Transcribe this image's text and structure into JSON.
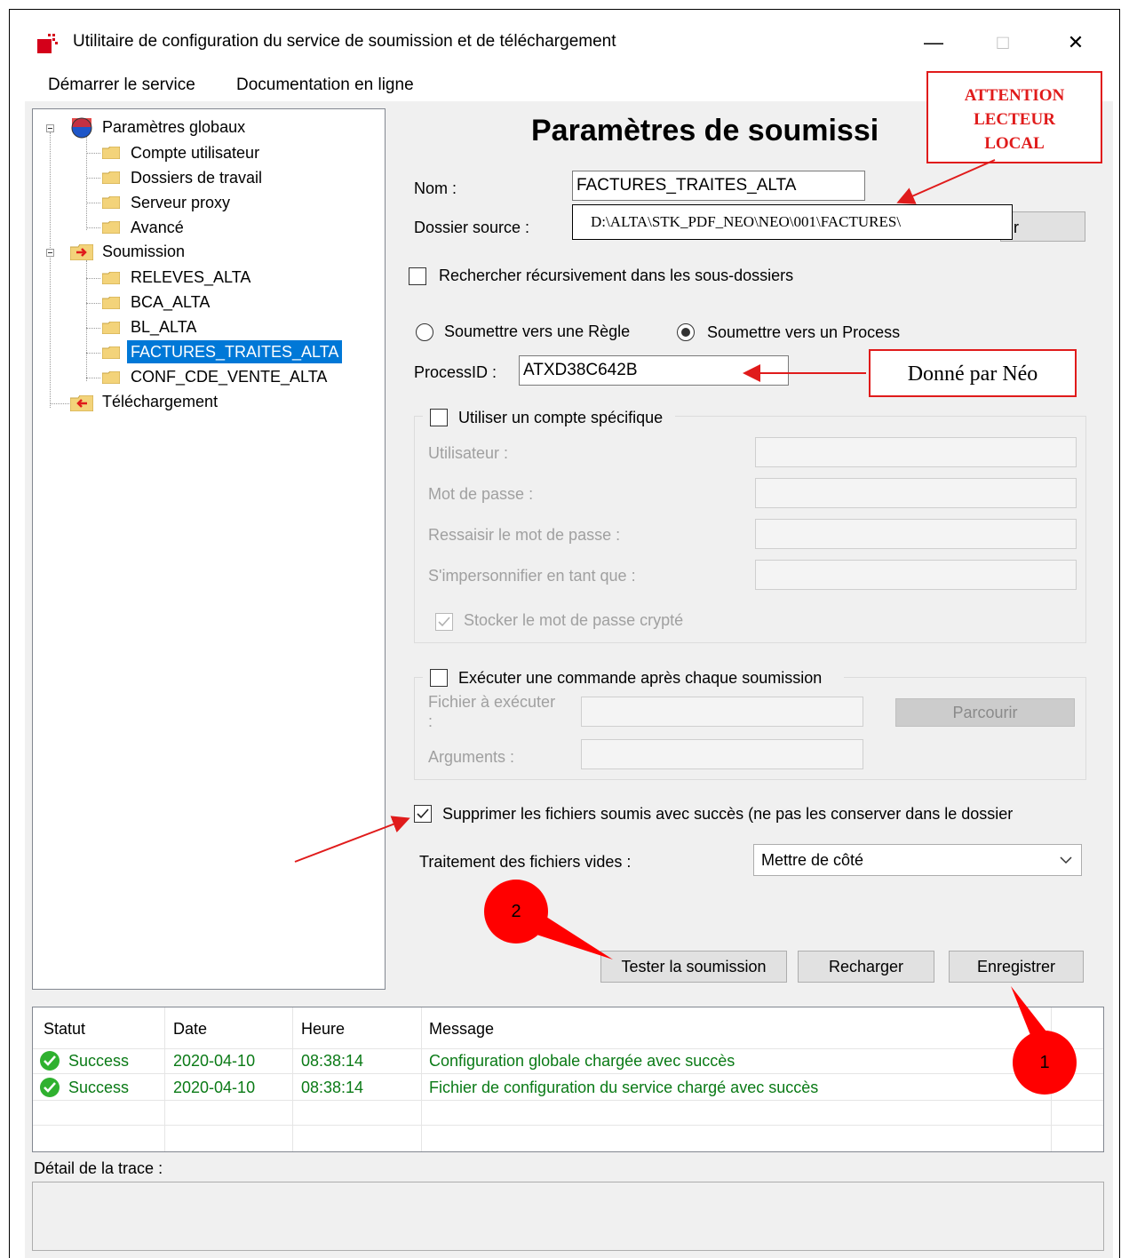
{
  "window": {
    "title": "Utilitaire de configuration du service de soumission et de téléchargement",
    "minimize": "—",
    "maximize": "□",
    "close": "✕"
  },
  "menu": [
    "Démarrer le service",
    "Documentation en ligne"
  ],
  "tree": {
    "global": "Paramètres globaux",
    "global_items": [
      "Compte utilisateur",
      "Dossiers de travail",
      "Serveur proxy",
      "Avancé"
    ],
    "submission": "Soumission",
    "submission_items": [
      "RELEVES_ALTA",
      "BCA_ALTA",
      "BL_ALTA",
      "FACTURES_TRAITES_ALTA",
      "CONF_CDE_VENTE_ALTA"
    ],
    "selected": "FACTURES_TRAITES_ALTA",
    "download": "Téléchargement"
  },
  "panel": {
    "title": "Paramètres de soumissi",
    "nom_label": "Nom :",
    "nom_value": "FACTURES_TRAITES_ALTA",
    "source_label": "Dossier source :",
    "source_value": "D:\\ALTA\\STK_PDF_NEO\\NEO\\001\\FACTURES\\",
    "browse_partial": "ir",
    "recursive_label": "Rechercher récursivement dans les sous-dossiers",
    "radio_rule": "Soumettre vers une Règle",
    "radio_process": "Soumettre vers un Process",
    "process_label": "ProcessID :",
    "process_value": "ATXD38C642B",
    "specific_account": "Utiliser un compte spécifique",
    "user_label": "Utilisateur :",
    "password_label": "Mot de passe :",
    "password_confirm_label": "Ressaisir le mot de passe :",
    "impersonate_label": "S'impersonnifier en tant que :",
    "store_encrypted": "Stocker le mot de passe crypté",
    "run_command": "Exécuter une commande après chaque soumission",
    "file_exec_label": "Fichier à exécuter",
    "file_exec_colon": ":",
    "browse_label": "Parcourir",
    "arguments_label": "Arguments :",
    "delete_label": "Supprimer les fichiers soumis avec succès (ne pas les conserver dans le dossier",
    "empty_files_label": "Traitement des fichiers vides :",
    "empty_files_value": "Mettre de côté",
    "btn_test": "Tester la soumission",
    "btn_reload": "Recharger",
    "btn_save": "Enregistrer"
  },
  "log": {
    "headers": [
      "Statut",
      "Date",
      "Heure",
      "Message"
    ],
    "rows": [
      {
        "status": "Success",
        "date": "2020-04-10",
        "time": "08:38:14",
        "message": "Configuration globale chargée avec succès"
      },
      {
        "status": "Success",
        "date": "2020-04-10",
        "time": "08:38:14",
        "message": "Fichier de configuration du service chargé avec succès"
      }
    ],
    "trace_label": "Détail de la trace :"
  },
  "annotations": {
    "attention": [
      "ATTENTION",
      "LECTEUR",
      "LOCAL"
    ],
    "donne": "Donné par Néo",
    "circle_1": "1",
    "circle_2": "2"
  },
  "colors": {
    "selection": "#0078d7",
    "annotation_red": "#e01b1b",
    "success_text": "#0a7a16"
  }
}
